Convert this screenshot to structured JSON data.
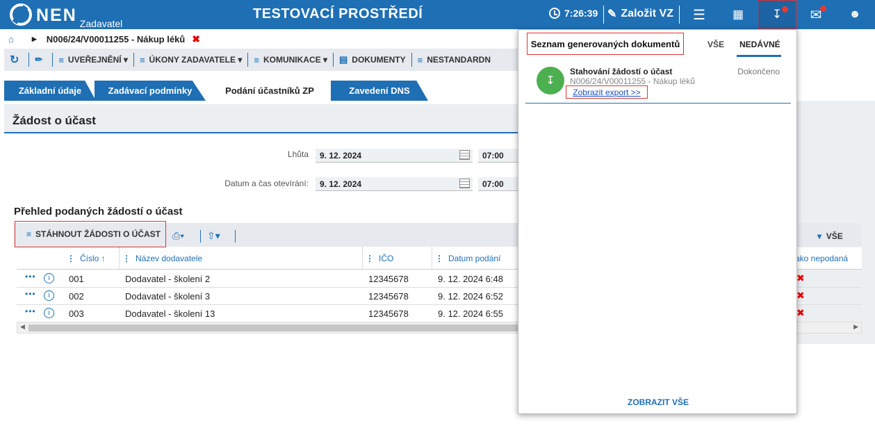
{
  "header": {
    "logo_text": "NEN",
    "logo_sub": "Zadavatel",
    "environment_title": "TESTOVACÍ PROSTŘEDÍ",
    "time": "7:26:39",
    "create_label": "Založit VZ"
  },
  "breadcrumb": {
    "record": "N006/24/V00011255 - Nákup léků"
  },
  "toolbar": {
    "items": [
      "UVEŘEJNĚNÍ",
      "ÚKONY ZADAVATELE",
      "KOMUNIKACE",
      "DOKUMENTY",
      "NESTANDARDN"
    ]
  },
  "tabs": [
    "Základní údaje",
    "Zadávací podmínky",
    "Podání účastníků ZP",
    "Zavedení DNS"
  ],
  "section": {
    "title": "Žádost o účast"
  },
  "form": {
    "deadline_label": "Lhůta",
    "deadline_date": "9. 12. 2024",
    "deadline_time": "07:00",
    "opening_label": "Datum a čas otevírání:",
    "opening_date": "9. 12. 2024",
    "opening_time": "07:00"
  },
  "overview": {
    "title": "Přehled podaných žádostí o účast",
    "download_button": "STÁHNOUT ŽÁDOSTI O ÚČAST",
    "view_all_label": "VŠE",
    "columns": [
      "Číslo",
      "Název dodavatele",
      "IČO",
      "Datum podání",
      "ako nepodaná"
    ],
    "rows": [
      {
        "number": "001",
        "supplier": "Dodavatel - školení 2",
        "ico": "12345678",
        "date": "9. 12. 2024 6:48"
      },
      {
        "number": "002",
        "supplier": "Dodavatel - školení 3",
        "ico": "12345678",
        "date": "9. 12. 2024 6:52"
      },
      {
        "number": "003",
        "supplier": "Dodavatel - školení 13",
        "ico": "12345678",
        "date": "9. 12. 2024 6:55"
      }
    ]
  },
  "popup": {
    "title": "Seznam generovaných dokumentů",
    "tab_all": "VŠE",
    "tab_recent": "NEDÁVNÉ",
    "item": {
      "name": "Stahování žádostí o účast",
      "record": "N006/24/V00011255 - Nákup léků",
      "link": "Zobrazit export >>",
      "status": "Dokončeno"
    },
    "show_all": "ZOBRAZIT VŠE"
  },
  "colors": {
    "brand_blue": "#1f6fb4",
    "highlight_red": "#dd3333",
    "success_green": "#4caf50"
  }
}
